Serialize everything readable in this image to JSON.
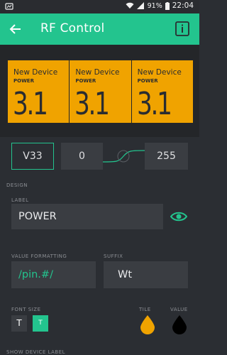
{
  "status_bar": {
    "battery_percent": "91%",
    "time": "22:04"
  },
  "app_bar": {
    "title": "RF Control"
  },
  "tiles": [
    {
      "name": "New Device",
      "label": "POWER",
      "value": "3.1"
    },
    {
      "name": "New Device",
      "label": "POWER",
      "value": "3.1"
    },
    {
      "name": "New Device",
      "label": "POWER",
      "value": "3.1"
    }
  ],
  "pin_settings": {
    "pin": "V33",
    "min": "0",
    "max": "255"
  },
  "design": {
    "section_title": "DESIGN",
    "label_title": "LABEL",
    "label_value": "POWER",
    "value_formatting_title": "VALUE FORMATTING",
    "value_formatting_value": "/pin.#/",
    "suffix_title": "SUFFIX",
    "suffix_value": "Wt",
    "font_size_title": "FONT SIZE",
    "font_small": "T",
    "font_large": "T",
    "tile_title": "TILE",
    "value_title": "VALUE",
    "tile_color": "#f0a300",
    "value_color": "#000000",
    "accent_color": "#23c48e",
    "show_device_label_title": "SHOW DEVICE LABEL"
  }
}
